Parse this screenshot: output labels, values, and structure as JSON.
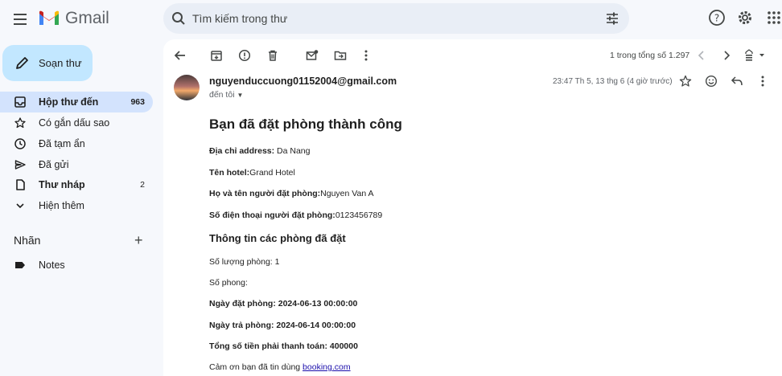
{
  "app": {
    "name": "Gmail"
  },
  "search": {
    "placeholder": "Tìm kiếm trong thư"
  },
  "sidebar": {
    "compose_label": "Soạn thư",
    "items": [
      {
        "label": "Hộp thư đến",
        "count": "963"
      },
      {
        "label": "Có gắn dấu sao",
        "count": ""
      },
      {
        "label": "Đã tạm ẩn",
        "count": ""
      },
      {
        "label": "Đã gửi",
        "count": ""
      },
      {
        "label": "Thư nháp",
        "count": "2"
      },
      {
        "label": "Hiện thêm",
        "count": ""
      }
    ],
    "labels_title": "Nhãn",
    "labels": [
      {
        "label": "Notes"
      }
    ]
  },
  "toolbar": {
    "pager": "1 trong tổng số 1.297"
  },
  "message": {
    "sender": "nguyenduccuong01152004@gmail.com",
    "to": "đến tôi",
    "time": "23:47 Th 5, 13 thg 6 (4 giờ trước)",
    "title": "Bạn đã đặt phòng thành công",
    "address_label": "Địa chỉ address:",
    "address_value": " Da Nang",
    "hotel_label": "Tên hotel:",
    "hotel_value": "Grand Hotel",
    "name_label": "Họ và tên người đặt phòng:",
    "name_value": "Nguyen Van A",
    "phone_label": "Số điện thoại người đặt phòng:",
    "phone_value": "0123456789",
    "rooms_heading": "Thông tin các phòng đã đặt",
    "room_count": "Số lượng phòng: 1",
    "room_number": "Số phong:",
    "checkin": "Ngày đặt phòng: 2024-06-13 00:00:00",
    "checkout": "Ngày trả phòng: 2024-06-14 00:00:00",
    "total": "Tổng số tiền phải thanh toán: 400000",
    "thanks_prefix": "Cảm ơn bạn đã tin dùng ",
    "thanks_link": "booking.com"
  },
  "colors": {
    "accent": "#c2e7ff",
    "active": "#d3e3fd",
    "background": "#f6f8fc",
    "link": "#1a0dab"
  },
  "icons": [
    "menu-icon",
    "gmail-logo",
    "search-icon",
    "tune-icon",
    "help-icon",
    "gear-icon",
    "apps-icon",
    "pencil-icon",
    "inbox-icon",
    "star-icon",
    "clock-icon",
    "send-icon",
    "draft-icon",
    "chevron-down-icon",
    "label-icon",
    "back-icon",
    "archive-icon",
    "report-icon",
    "delete-icon",
    "mark-unread-icon",
    "move-icon",
    "more-vert-icon",
    "chevron-left-icon",
    "chevron-right-icon",
    "keyboard-icon",
    "emoji-icon",
    "reply-icon"
  ]
}
